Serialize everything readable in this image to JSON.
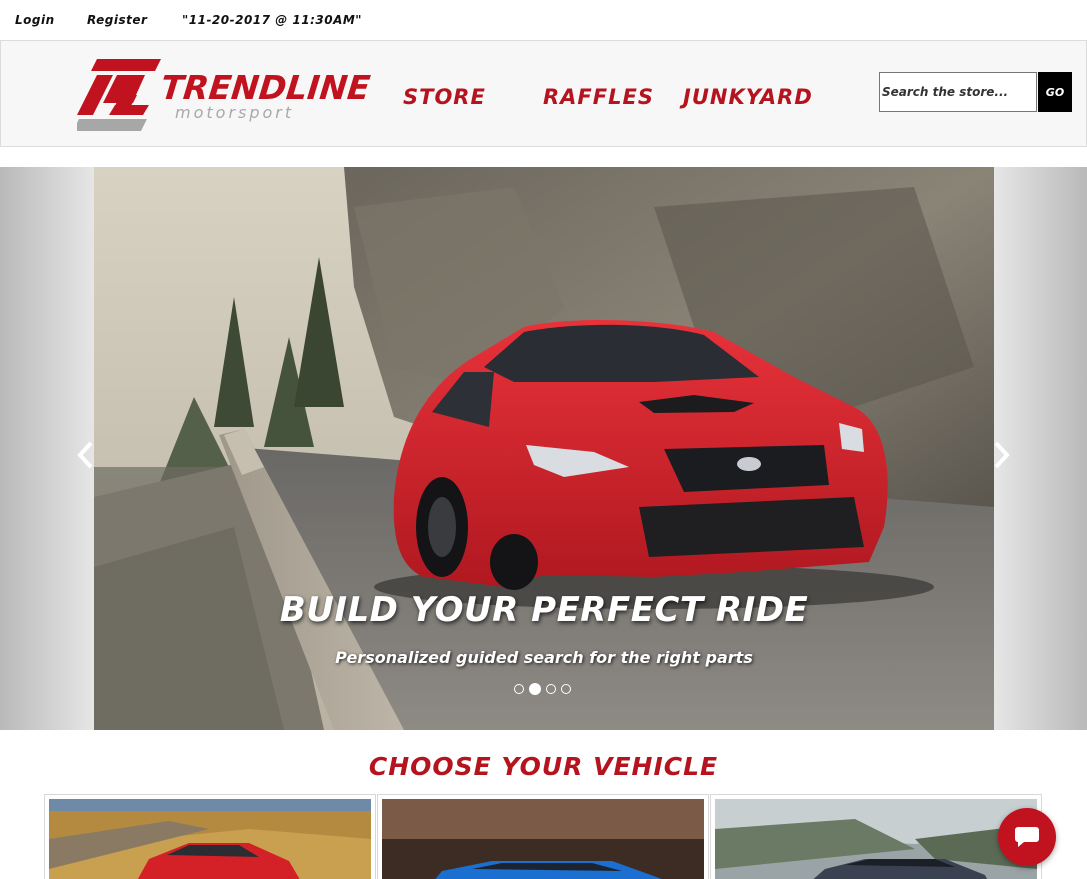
{
  "topbar": {
    "login": "Login",
    "register": "Register",
    "datetime": "\"11-20-2017 @ 11:30AM\""
  },
  "header": {
    "logo_text": "TRENDLINE",
    "logo_sub": "motorsport",
    "nav": {
      "store": "STORE",
      "raffles": "RAFFLES",
      "junkyard": "JUNKYARD"
    },
    "search": {
      "placeholder": "Search the store...",
      "button": "GO"
    }
  },
  "carousel": {
    "title": "BUILD YOUR PERFECT RIDE",
    "subtitle": "Personalized guided search for the right parts",
    "slide_count": 4,
    "active_slide": 2
  },
  "vehicles": {
    "title": "CHOOSE YOUR VEHICLE"
  },
  "colors": {
    "brand_red": "#b5131e",
    "header_bg": "#f7f7f7"
  },
  "icons": {
    "prev": "chevron-left-icon",
    "next": "chevron-right-icon",
    "chat": "chat-bubble-icon"
  }
}
